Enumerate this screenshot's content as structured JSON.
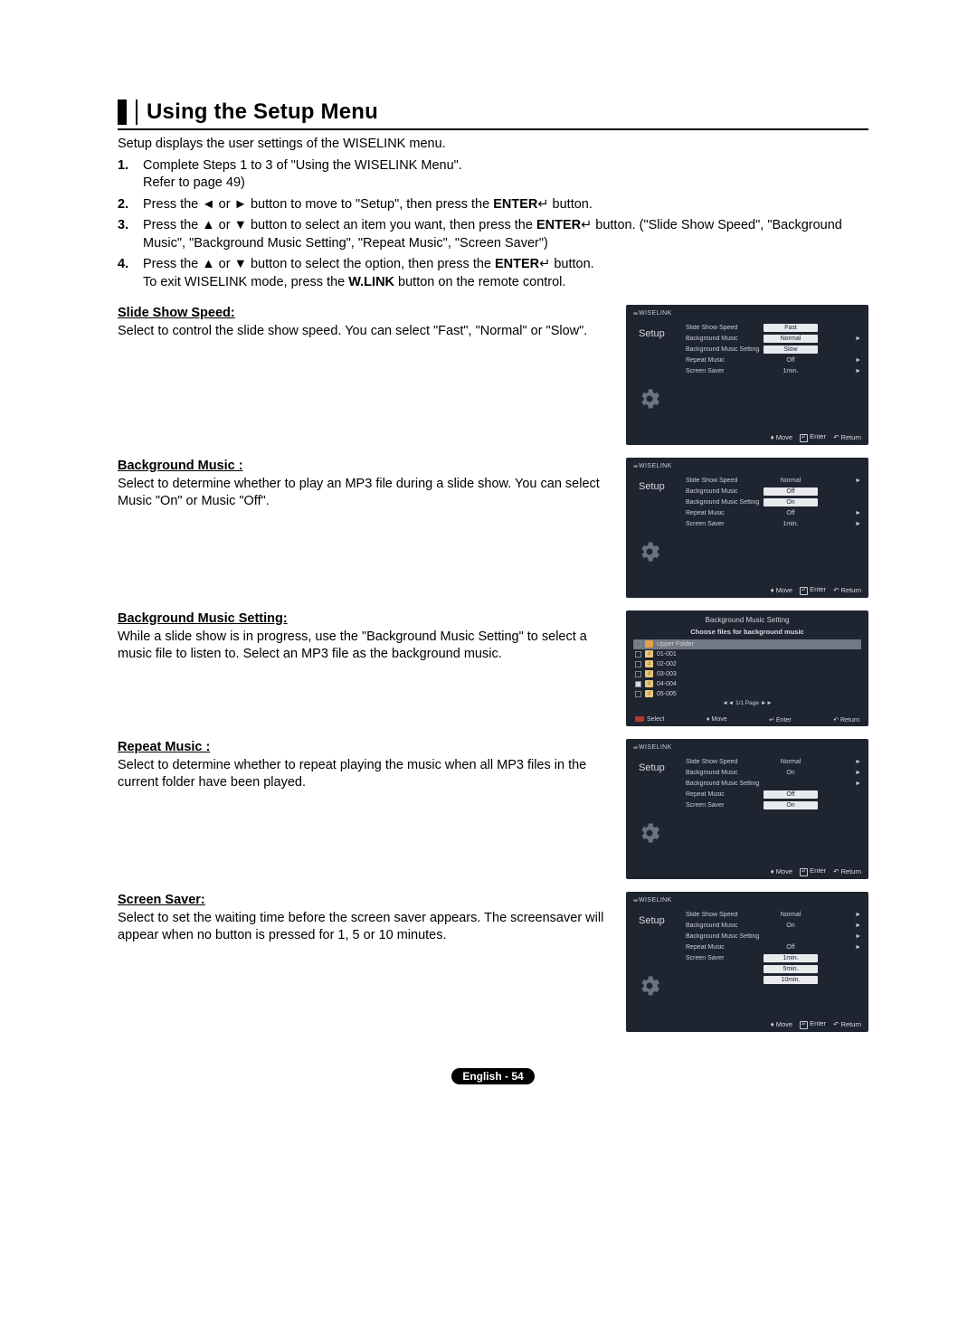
{
  "title": "Using the Setup Menu",
  "intro": "Setup displays the user settings of the WISELINK menu.",
  "steps": [
    {
      "num": "1.",
      "html": "Complete Steps 1 to 3 of \"Using the WISELINK Menu\".<br>Refer to page 49)"
    },
    {
      "num": "2.",
      "html": "Press the ◄ or ► button to move to \"Setup\", then press the <b>ENTER</b>↵ button."
    },
    {
      "num": "3.",
      "html": "Press the ▲ or ▼ button to select an item you want, then press the <b>ENTER</b>↵ button. (\"Slide Show Speed\", \"Background Music\", \"Background Music Setting\", \"Repeat Music\", \"Screen Saver\")"
    },
    {
      "num": "4.",
      "html": "Press the ▲ or ▼ button to select the option, then press the <b>ENTER</b>↵ button.<br>To exit WISELINK mode, press the <b>W.LINK</b> button on the remote control."
    }
  ],
  "sections": {
    "slide": {
      "heading": "Slide Show Speed:",
      "body": "Select to control the slide show speed. You can select \"Fast\", \"Normal\" or \"Slow\"."
    },
    "bgmusic": {
      "heading": "Background Music :",
      "body": "Select to determine whether to play an MP3 file during a slide show. You can select Music \"On\" or Music \"Off\"."
    },
    "bgmset": {
      "heading": "Background Music Setting:",
      "body": "While a slide show is in progress, use the \"Background Music Setting\" to select a music file to listen to. Select an MP3 file as the background music."
    },
    "repeat": {
      "heading": "Repeat Music :",
      "body": "Select to determine whether to repeat playing the music when all MP3 files in the current folder have been played."
    },
    "saver": {
      "heading": "Screen Saver:",
      "body": "Select to set the waiting time before the screen saver appears. The screensaver will appear when no button is pressed for 1, 5 or 10 minutes."
    }
  },
  "tv_common": {
    "brand": "WISELINK",
    "side": "Setup",
    "labels": {
      "slide": "Slide Show Speed",
      "bg": "Background Music",
      "bgset": "Background Music Setting",
      "rep": "Repeat Music",
      "ss": "Screen Saver"
    },
    "hint_move": "Move",
    "hint_enter": "Enter",
    "hint_return": "Return",
    "hint_select": "Select"
  },
  "tv1": {
    "vals": {
      "slide_sel": "Fast",
      "slide_alt1": "Normal",
      "slide_alt2": "Slow",
      "rep": "Off",
      "ss": "1min."
    }
  },
  "tv2": {
    "vals": {
      "slide": "Normal",
      "bg_sel": "Off",
      "bg_alt": "On",
      "rep": "Off",
      "ss": "1min."
    }
  },
  "tv3": {
    "title": "Background Music Setting",
    "subtitle": "Choose files for background music",
    "files": [
      "Upper Folder",
      "01-001",
      "02-002",
      "03-003",
      "04-004",
      "05-005"
    ],
    "page": "◄◄ 1/1 Page ►►"
  },
  "tv4": {
    "vals": {
      "slide": "Normal",
      "bg": "On",
      "rep_sel": "Off",
      "rep_alt": "On"
    }
  },
  "tv5": {
    "vals": {
      "slide": "Normal",
      "bg": "On",
      "rep": "Off",
      "ss_a": "1min.",
      "ss_b": "5min.",
      "ss_c": "10min."
    }
  },
  "footer": "English - 54"
}
